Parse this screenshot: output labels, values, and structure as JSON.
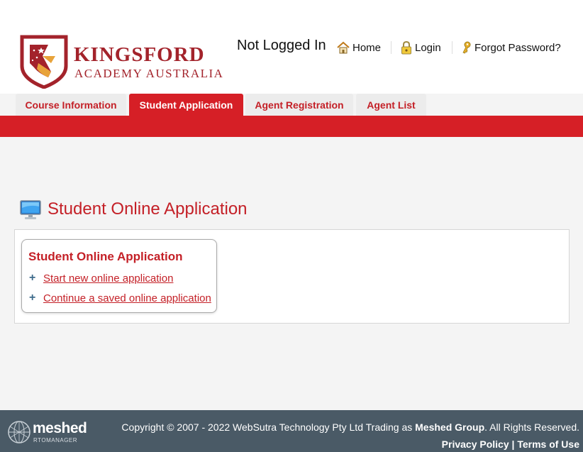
{
  "header": {
    "logo": {
      "name": "KINGSFORD",
      "subtitle": "ACADEMY AUSTRALIA"
    },
    "status": "Not Logged In",
    "links": [
      {
        "label": "Home",
        "icon": "home-icon"
      },
      {
        "label": "Login",
        "icon": "lock-icon"
      },
      {
        "label": "Forgot Password?",
        "icon": "key-icon"
      }
    ]
  },
  "tabs": [
    {
      "label": "Course Information",
      "active": false
    },
    {
      "label": "Student Application",
      "active": true
    },
    {
      "label": "Agent Registration",
      "active": false
    },
    {
      "label": "Agent List",
      "active": false
    }
  ],
  "main": {
    "title": "Student Online Application",
    "box": {
      "title": "Student Online Application",
      "links": [
        {
          "label": "Start new online application"
        },
        {
          "label": "Continue a saved online application"
        }
      ]
    }
  },
  "footer": {
    "brand": {
      "name": "meshed",
      "sub": "RTOMANAGER"
    },
    "copyright_prefix": "Copyright © 2007 - 2022 WebSutra Technology Pty Ltd Trading as ",
    "copyright_company": "Meshed Group",
    "copyright_suffix": ". All Rights Reserved.",
    "privacy": "Privacy Policy",
    "separator": " | ",
    "terms": "Terms of Use"
  },
  "colors": {
    "brand_red": "#d61f26",
    "text_red": "#c42027",
    "logo_red": "#a3232b",
    "footer_bg": "#4a5a66",
    "page_bg": "#f4f4f4"
  }
}
